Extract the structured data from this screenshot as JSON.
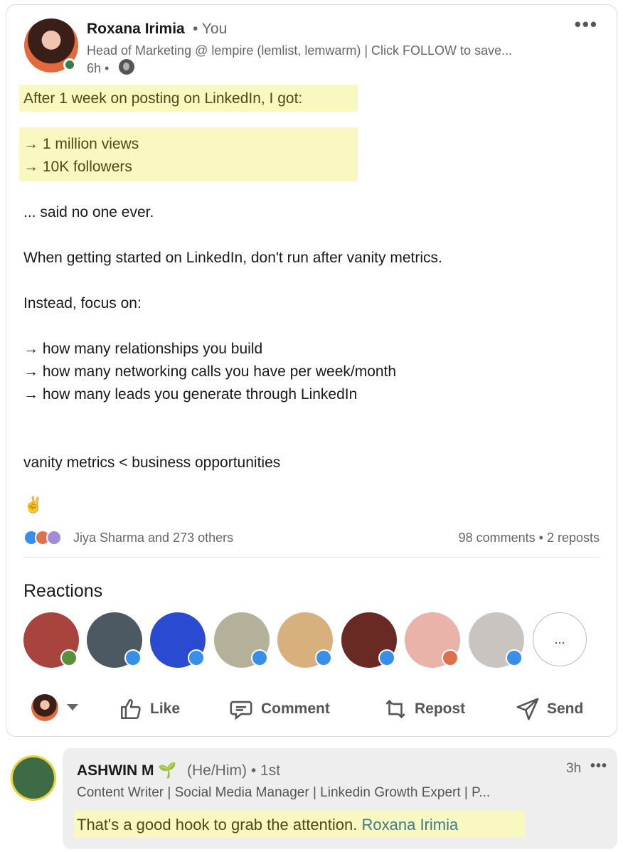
{
  "post": {
    "author": {
      "name": "Roxana Irimia",
      "connection": "• You",
      "headline": "Head of Marketing @ lempire (lemlist, lemwarm) | Click FOLLOW to save...",
      "time": "6h •"
    },
    "more_label": "•••",
    "body": {
      "l1": "After 1 week on posting on LinkedIn, I got:",
      "l2": "→ 1 million views",
      "l3": "→ 10K followers",
      "l4": "... said no one ever.",
      "l5": "When getting started on LinkedIn, don't run after vanity metrics.",
      "l6": "Instead, focus on:",
      "l7": "→ how many relationships you build",
      "l8": "→ how many networking calls you have per week/month",
      "l9": "→ how many leads you generate through LinkedIn",
      "l10": "vanity metrics < business opportunities",
      "emoji": "✌️"
    },
    "social": {
      "reactions_text": "Jiya Sharma and 273 others",
      "comments_reposts": "98 comments • 2 reposts"
    },
    "reactions_title": "Reactions",
    "reactors_more": "...",
    "actions": {
      "like": "Like",
      "comment": "Comment",
      "repost": "Repost",
      "send": "Send"
    }
  },
  "comment": {
    "name": "ASHWIN M 🌱",
    "pronouns": "(He/Him) • 1st",
    "time": "3h",
    "more": "•••",
    "headline": "Content Writer | Social Media Manager | Linkedin Growth Expert | P...",
    "text": "That's a good hook to grab the attention.",
    "mention": "Roxana Irimia"
  },
  "colors": {
    "highlight": "#f8f8c0",
    "online": "#3a7d44",
    "like_blue": "#378fe9",
    "mention": "#3f7c8a"
  }
}
